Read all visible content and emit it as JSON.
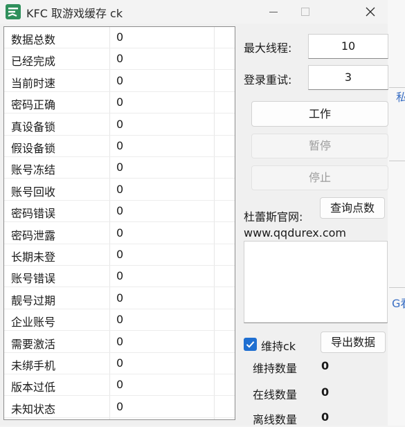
{
  "window": {
    "title": "KFC 取游戏缓存 ck",
    "icons": {
      "app": "app-logo-icon",
      "minimize": "minimize-icon",
      "maximize": "maximize-icon",
      "close": "close-icon"
    }
  },
  "stats_table": {
    "rows": [
      {
        "label": "数据总数",
        "value": "0"
      },
      {
        "label": "已经完成",
        "value": "0"
      },
      {
        "label": "当前时速",
        "value": "0"
      },
      {
        "label": "密码正确",
        "value": "0"
      },
      {
        "label": "真设备锁",
        "value": "0"
      },
      {
        "label": "假设备锁",
        "value": "0"
      },
      {
        "label": "账号冻结",
        "value": "0"
      },
      {
        "label": "账号回收",
        "value": "0"
      },
      {
        "label": "密码错误",
        "value": "0"
      },
      {
        "label": "密码泄露",
        "value": "0"
      },
      {
        "label": "长期未登",
        "value": "0"
      },
      {
        "label": "账号错误",
        "value": "0"
      },
      {
        "label": "靓号过期",
        "value": "0"
      },
      {
        "label": "企业账号",
        "value": "0"
      },
      {
        "label": "需要激活",
        "value": "0"
      },
      {
        "label": "未绑手机",
        "value": "0"
      },
      {
        "label": "版本过低",
        "value": "0"
      },
      {
        "label": "未知状态",
        "value": "0"
      }
    ]
  },
  "settings": {
    "max_threads_label": "最大线程:",
    "max_threads_value": "10",
    "login_retry_label": "登录重试:",
    "login_retry_value": "3"
  },
  "buttons": {
    "work": "工作",
    "pause": "暂停",
    "stop": "停止",
    "query_points": "查询点数",
    "export_data": "导出数据"
  },
  "site": {
    "label": "杜蕾斯官网:",
    "url": "www.qqdurex.com"
  },
  "keep_alive": {
    "checkbox_label": "维持ck",
    "checked": true,
    "check_icon": "checkmark-icon",
    "maintain_count_label": "维持数量",
    "maintain_count_value": "0",
    "online_count_label": "在线数量",
    "online_count_value": "0",
    "offline_count_label": "离线数量",
    "offline_count_value": "0"
  },
  "background": {
    "fragment_1": "私",
    "fragment_2": "G看",
    "accent_color": "#1f6fd1"
  }
}
